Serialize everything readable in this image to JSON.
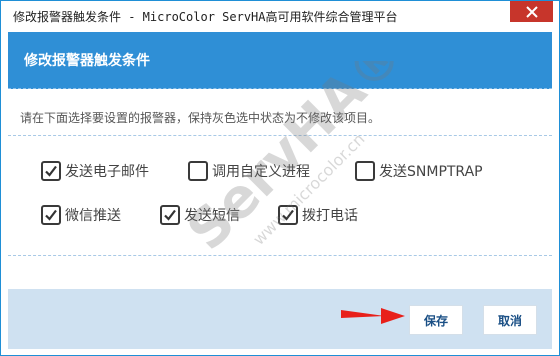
{
  "window": {
    "title": "修改报警器触发条件 - MicroColor ServHA高可用软件综合管理平台"
  },
  "header": {
    "title": "修改报警器触发条件"
  },
  "content": {
    "hint": "请在下面选择要设置的报警器，保持灰色选中状态为不修改该项目。",
    "options": [
      {
        "label": "发送电子邮件",
        "checked": true
      },
      {
        "label": "调用自定义进程",
        "checked": false
      },
      {
        "label": "发送SNMPTRAP",
        "checked": false
      },
      {
        "label": "微信推送",
        "checked": true
      },
      {
        "label": "发送短信",
        "checked": true
      },
      {
        "label": "拨打电话",
        "checked": true
      }
    ]
  },
  "footer": {
    "save_label": "保存",
    "cancel_label": "取消"
  },
  "watermark": {
    "logo": "ServHA®",
    "url": "www.microcolor.cn"
  },
  "colors": {
    "accent": "#2f8fd6",
    "footer": "#cfe1f1",
    "close": "#c7352b",
    "arrow": "#e8201a"
  },
  "icons": {
    "close": "close-icon",
    "check": "checkmark-icon",
    "pointer": "red-arrow-icon"
  }
}
